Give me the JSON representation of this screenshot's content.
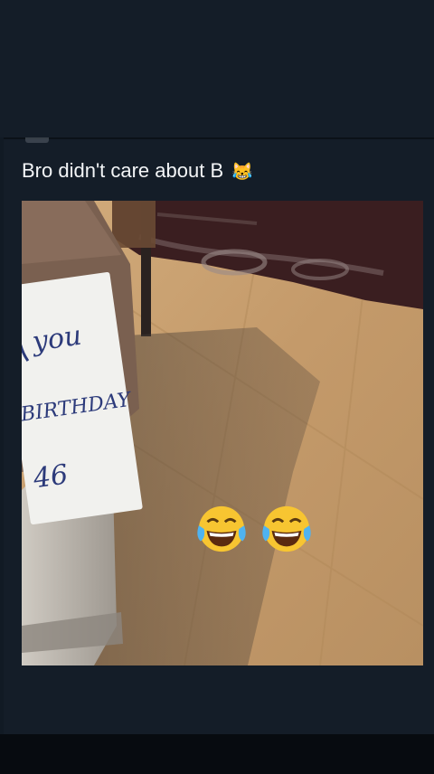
{
  "post": {
    "caption_text": "Bro didn't care about B",
    "caption_emoji": "😹"
  },
  "sign": {
    "line1": "you",
    "line2": "BIRTHDAY",
    "line3": "46"
  },
  "overlay": {
    "emoji_left": "😂",
    "emoji_right": "😂"
  },
  "colors": {
    "background": "#111a24",
    "card": "#141d28",
    "text": "#f3f5f7",
    "floor": "#c9a072",
    "carpet": "#3a1e20"
  }
}
